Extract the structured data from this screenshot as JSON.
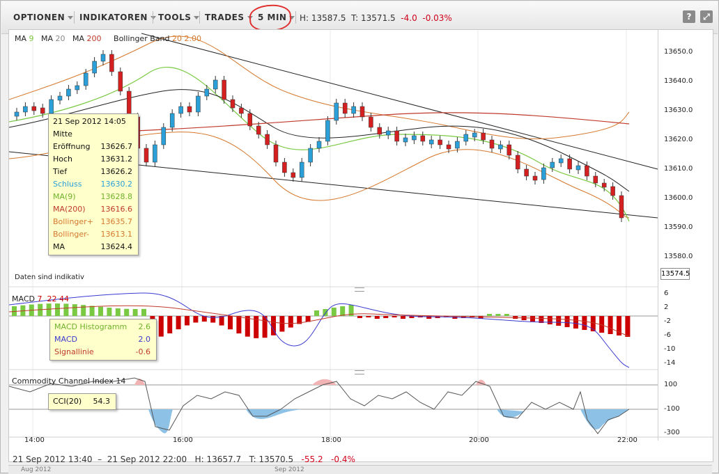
{
  "toolbar": {
    "menus": [
      "OPTIONEN",
      "INDIKATOREN",
      "TOOLS",
      "TRADES"
    ],
    "interval": "5 MIN",
    "high": "H: 13587.5",
    "low": "T: 13571.5",
    "change": "-4.0",
    "change_pct": "-0.03%",
    "help": "?",
    "expand": "⤢"
  },
  "main": {
    "legend": {
      "ma9_label": "MA",
      "ma9_val": "9",
      "ma20_label": "MA",
      "ma20_val": "20",
      "ma200_label": "MA",
      "ma200_val": "200",
      "bb_label": "Bollinger Band",
      "bb_val": "20 2.00"
    },
    "y_ticks": [
      "13650.0",
      "13640.0",
      "13630.0",
      "13620.0",
      "13610.0",
      "13600.0",
      "13590.0",
      "13580.0"
    ],
    "last_price": "13574.5",
    "note": "Daten sind indikativ"
  },
  "tooltip": {
    "date": "21 Sep 2012 14:05",
    "mitte": "Mitte",
    "rows": [
      {
        "label": "Eröffnung",
        "value": "13626.7"
      },
      {
        "label": "Hoch",
        "value": "13631.2"
      },
      {
        "label": "Tief",
        "value": "13626.2"
      },
      {
        "label": "Schluss",
        "value": "13630.2"
      },
      {
        "label": "MA(9)",
        "value": "13628.8"
      },
      {
        "label": "MA(200)",
        "value": "13616.6"
      },
      {
        "label": "Bollinger+",
        "value": "13635.7"
      },
      {
        "label": "Bollinger-",
        "value": "13613.1"
      },
      {
        "label": "MA",
        "value": "13624.4"
      }
    ]
  },
  "macd": {
    "label": "MACD",
    "p1": "7",
    "p2": "22",
    "p3": "44",
    "y_ticks": [
      "6",
      "2",
      "-2",
      "-6",
      "-10",
      "-14"
    ],
    "tip": [
      {
        "label": "MACD Histogramm",
        "value": "2.6"
      },
      {
        "label": "MACD",
        "value": "2.0"
      },
      {
        "label": "Signallinie",
        "value": "-0.6"
      }
    ]
  },
  "cci": {
    "label": "Commodity Channel Index",
    "period": "14",
    "y_ticks": [
      "100",
      "-100",
      "-300"
    ],
    "tip_label": "CCI(20)",
    "tip_value": "54.3"
  },
  "x_ticks": [
    "14:00",
    "16:00",
    "18:00",
    "20:00",
    "22:00"
  ],
  "footer": {
    "start": "21 Sep 2012 13:40",
    "end": "21 Sep 2012 22:00",
    "high": "H: 13657.7",
    "low": "T: 13570.5",
    "change": "-55.2",
    "change_pct": "-0.4%"
  },
  "navigator": {
    "left": "Aug 2012",
    "right": "Sep 2012"
  },
  "colors": {
    "up": "#2b9fd8",
    "down": "#d42020",
    "ma9": "#7ac943",
    "ma200": "#c0392b",
    "bollinger": "#d5782d",
    "macd": "#3a3ad0",
    "hist_pos": "#7ac943",
    "hist_neg": "#cc0000",
    "cci_fill": "#8ec1e6"
  },
  "chart_data": {
    "type": "line",
    "title": "",
    "x_labels": [
      "14:00",
      "16:00",
      "18:00",
      "20:00",
      "22:00"
    ],
    "y_range": [
      13570,
      13657
    ],
    "last_close": 13574.5,
    "series": [
      {
        "name": "MA(9)",
        "values": [
          13628.8
        ]
      },
      {
        "name": "MA(200)",
        "values": [
          13616.6
        ]
      },
      {
        "name": "Bollinger+",
        "values": [
          13635.7
        ]
      },
      {
        "name": "Bollinger-",
        "values": [
          13613.1
        ]
      }
    ]
  }
}
